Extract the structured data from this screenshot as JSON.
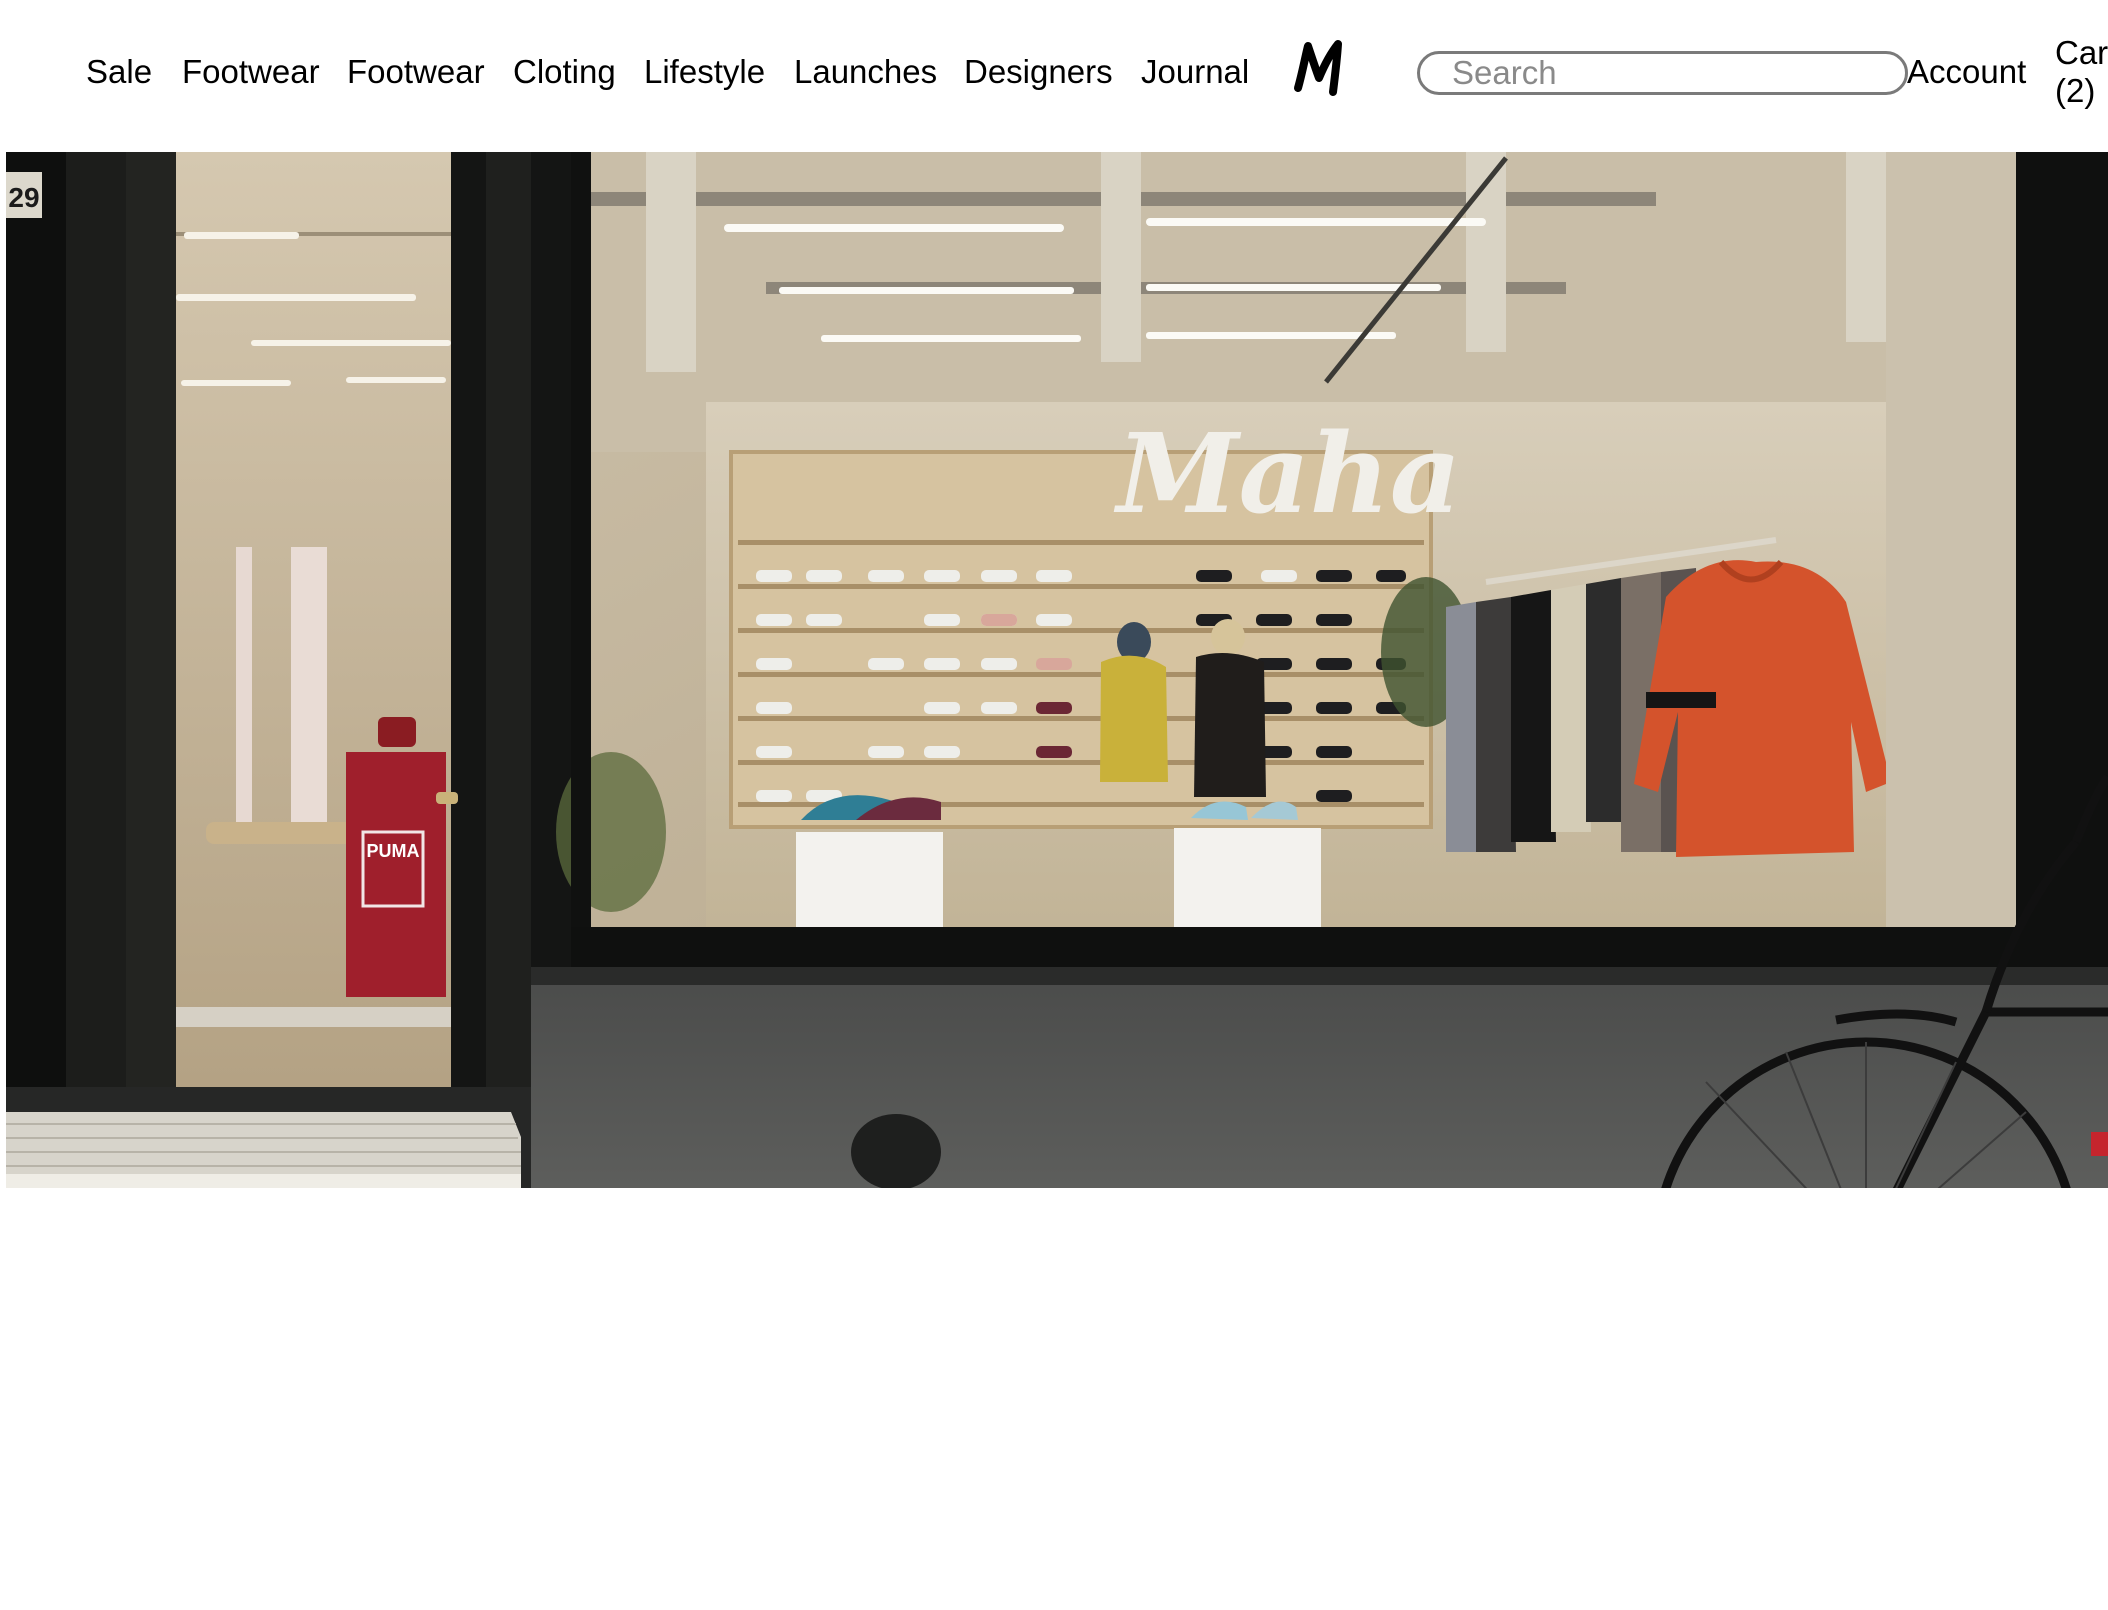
{
  "nav": {
    "items": [
      {
        "label": "Sale"
      },
      {
        "label": "Footwear"
      },
      {
        "label": "Footwear"
      },
      {
        "label": "Cloting"
      },
      {
        "label": "Lifestyle"
      },
      {
        "label": "Launches"
      },
      {
        "label": "Designers"
      },
      {
        "label": "Journal"
      }
    ]
  },
  "logo": {
    "icon": "maha-logo-icon"
  },
  "search": {
    "placeholder": "Search",
    "value": ""
  },
  "account": {
    "label": "Account"
  },
  "cart": {
    "label": "Cart",
    "count": "(2)"
  },
  "hero": {
    "store_sign": "Maha",
    "house_number": "29",
    "box_brand": "PUMA"
  },
  "colors": {
    "text": "#000000",
    "background": "#ffffff",
    "search_border": "#7a7a7a",
    "hoodie": "#d4532c"
  }
}
